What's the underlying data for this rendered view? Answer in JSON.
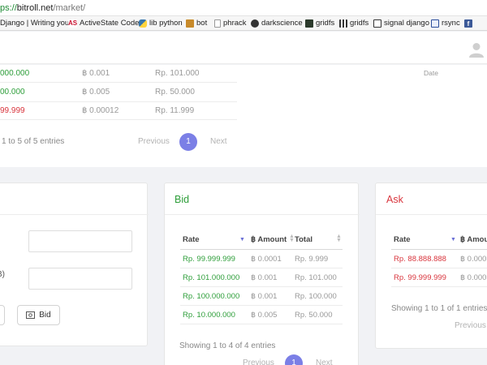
{
  "browser": {
    "url_scheme": "ps://",
    "url_host": "bitroll.net",
    "url_path": "/market/",
    "bookmarks": [
      {
        "label": "Django | Writing you...",
        "icon": "django-icon"
      },
      {
        "label": "ActiveState Code",
        "icon": "activestate-icon"
      },
      {
        "label": "lib python",
        "icon": "python-icon"
      },
      {
        "label": "bot",
        "icon": "bot-icon"
      },
      {
        "label": "phrack",
        "icon": "page-icon"
      },
      {
        "label": "darkscience",
        "icon": "darkscience-icon"
      },
      {
        "label": "gridfs",
        "icon": "gridfs-icon"
      },
      {
        "label": "gridfs",
        "icon": "gridfs-qr-icon"
      },
      {
        "label": "signal django",
        "icon": "signal-icon"
      },
      {
        "label": "rsync",
        "icon": "rsync-icon"
      },
      {
        "label": "",
        "icon": "facebook-icon"
      }
    ]
  },
  "colors": {
    "green": "#2e9e3a",
    "red": "#d9363e",
    "accent": "#7b7fe6"
  },
  "top_table": {
    "date_header": "Date",
    "rows": [
      {
        "col1": "000.000",
        "col1_color": "green",
        "amount": "฿ 0.001",
        "total": "Rp. 101.000"
      },
      {
        "col1": "00.000",
        "col1_color": "green",
        "amount": "฿ 0.005",
        "total": "Rp. 50.000"
      },
      {
        "col1": "99.999",
        "col1_color": "red",
        "amount": "฿ 0.00012",
        "total": "Rp. 11.999"
      }
    ],
    "info": "1 to 5 of 5 entries",
    "previous": "Previous",
    "page": "1",
    "next": "Next"
  },
  "order_form": {
    "amount_label_fragment": "B)",
    "bid_button": "Bid"
  },
  "bid": {
    "title": "Bid",
    "headers": {
      "rate": "Rate",
      "amount": "฿ Amount",
      "total": "Total"
    },
    "rows": [
      {
        "rate": "Rp. 99.999.999",
        "amount": "฿ 0.0001",
        "total": "Rp. 9.999"
      },
      {
        "rate": "Rp. 101.000.000",
        "amount": "฿ 0.001",
        "total": "Rp. 101.000"
      },
      {
        "rate": "Rp. 100.000.000",
        "amount": "฿ 0.001",
        "total": "Rp. 100.000"
      },
      {
        "rate": "Rp. 10.000.000",
        "amount": "฿ 0.005",
        "total": "Rp. 50.000"
      }
    ],
    "info": "Showing 1 to 4 of 4 entries",
    "previous": "Previous",
    "page": "1",
    "next": "Next"
  },
  "ask": {
    "title": "Ask",
    "headers": {
      "rate": "Rate",
      "amount": "฿ Amou"
    },
    "rows": [
      {
        "rate": "Rp. 88.888.888",
        "amount": "฿ 0.000"
      },
      {
        "rate": "Rp. 99.999.999",
        "amount": "฿ 0.000"
      }
    ],
    "info": "Showing 1 to 1 of 1 entries",
    "previous": "Previous"
  }
}
